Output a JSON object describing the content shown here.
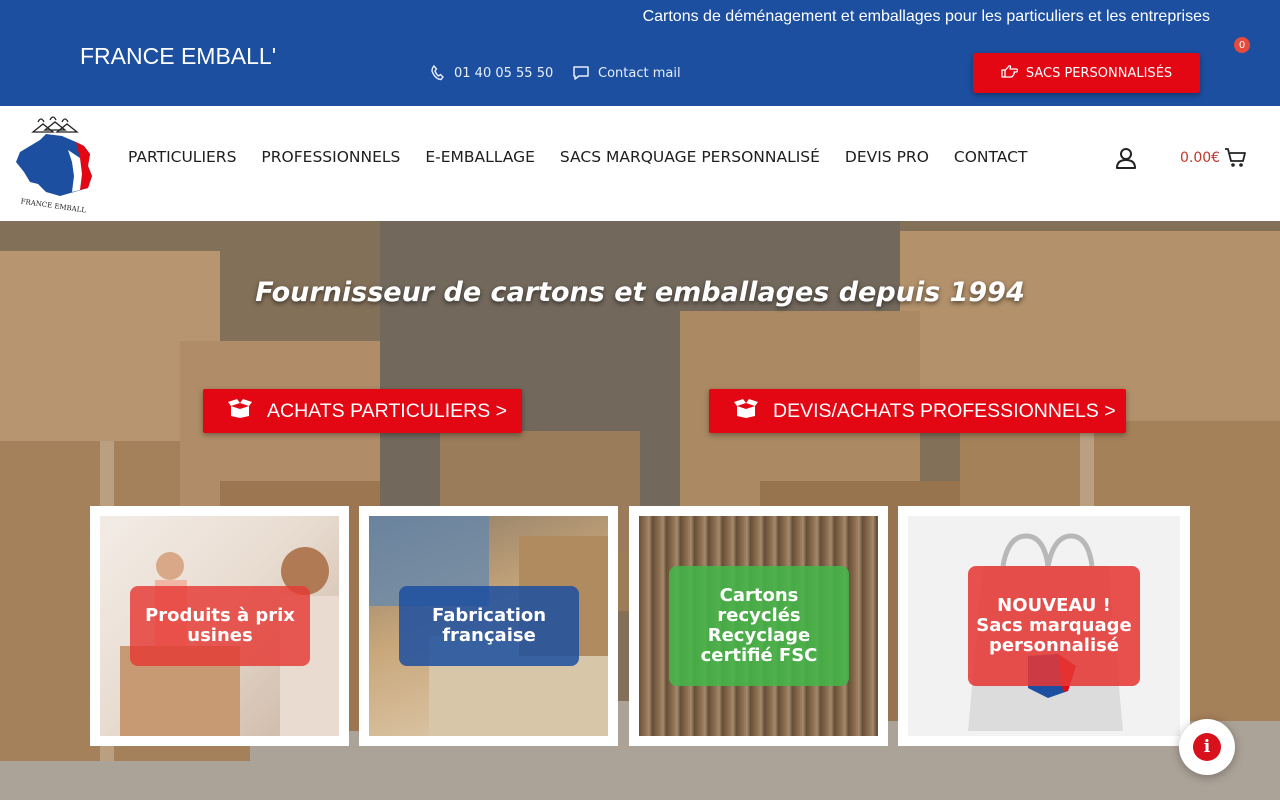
{
  "topbar": {
    "tagline": "Cartons de déménagement et emballages pour les particuliers et les entreprises",
    "brand": "FRANCE EMBALL'",
    "phone": "01 40 05 55 50",
    "mail": "Contact mail",
    "bags_button": "SACS PERSONNALISÉS",
    "bg_color": "#1c4fa0",
    "accent_color": "#e30613"
  },
  "logo": {
    "text": "FRANCE EMBALL"
  },
  "nav": {
    "items": [
      "PARTICULIERS",
      "PROFESSIONNELS",
      "E-EMBALLAGE",
      "SACS MARQUAGE PERSONNALISÉ",
      "DEVIS PRO",
      "CONTACT"
    ],
    "cart_total": "0.00€",
    "cart_count": "0"
  },
  "hero": {
    "title": "Fournisseur de cartons et emballages depuis 1994",
    "cta_particuliers": "ACHATS PARTICULIERS >",
    "cta_pro": "DEVIS/ACHATS PROFESSIONNELS >",
    "cards": [
      {
        "label": "Produits à prix usines",
        "color": "#e53935"
      },
      {
        "label": "Fabrication française",
        "color": "#1c4fa0"
      },
      {
        "label": "Cartons recyclés Recyclage certifié FSC",
        "color": "#43b649"
      },
      {
        "label": "NOUVEAU ! Sacs marquage personnalisé",
        "color": "#e53935"
      }
    ]
  },
  "icons": {
    "phone": "phone-icon",
    "mail": "chat-icon",
    "hand": "hand-pointer-icon",
    "box": "box-icon",
    "account": "user-icon",
    "cart": "cart-icon",
    "info": "info-icon"
  }
}
